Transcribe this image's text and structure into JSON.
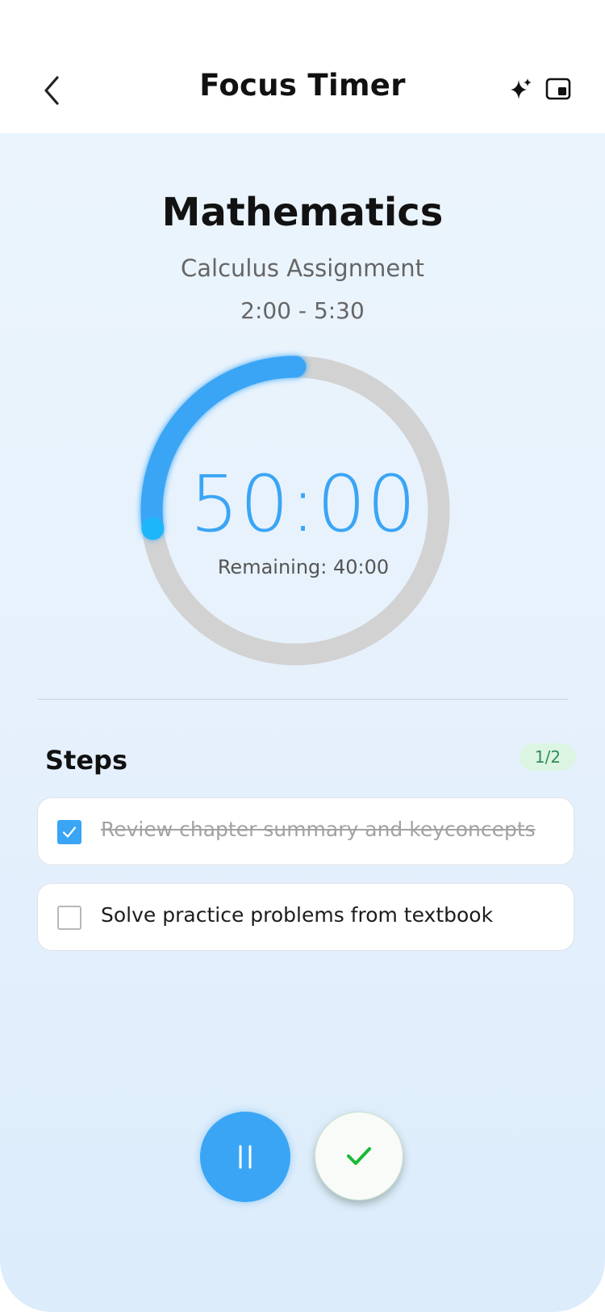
{
  "header": {
    "title": "Focus Timer",
    "back_icon": "chevron-left-icon",
    "sparkle_icon": "sparkle-icon",
    "pip_icon": "picture-in-picture-icon"
  },
  "session": {
    "subject": "Mathematics",
    "task": "Calculus Assignment",
    "time_range": "2:00 - 5:30"
  },
  "timer": {
    "value": "50:00",
    "remaining_label": "Remaining: 40:00",
    "progress_fraction": 0.27
  },
  "steps": {
    "title": "Steps",
    "badge": "1/2",
    "items": [
      {
        "text": "Review  chapter summary and keyconcepts",
        "done": true
      },
      {
        "text": "Solve practice problems from textbook",
        "done": false
      }
    ]
  },
  "controls": {
    "pause_icon": "pause-icon",
    "complete_icon": "checkmark-icon"
  },
  "colors": {
    "accent": "#3aa5f5",
    "ring_track": "#d2d2d2",
    "success": "#19b934",
    "badge_bg": "#dcf5e3"
  }
}
